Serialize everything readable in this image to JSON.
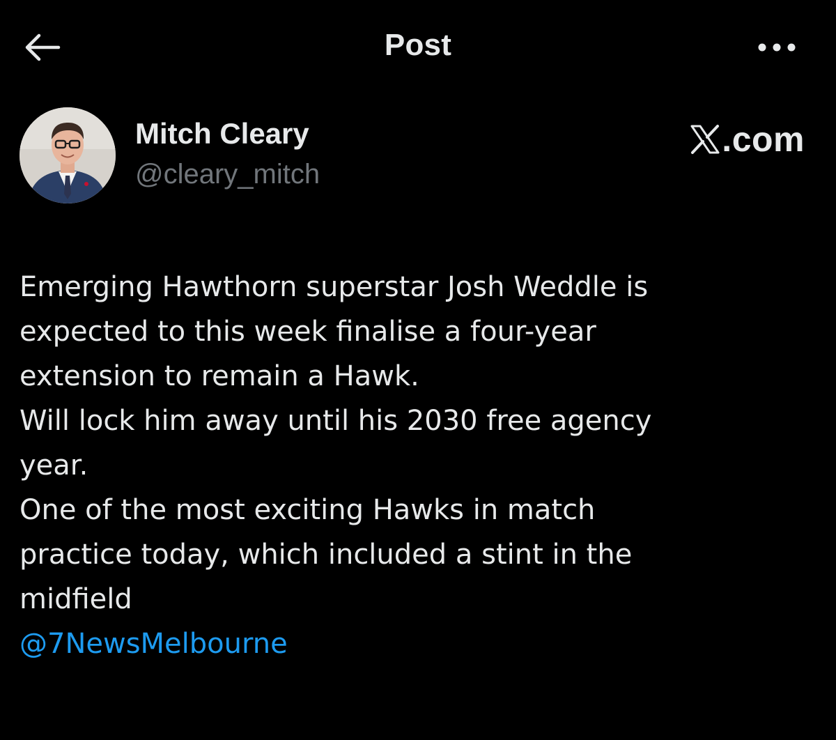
{
  "header": {
    "title": "Post",
    "back_icon": "arrow-left-icon",
    "more_icon": "more-horizontal-icon"
  },
  "author": {
    "name": "Mitch Cleary",
    "handle": "@cleary_mitch"
  },
  "watermark": {
    "logo_letter": "X",
    "text": ".com"
  },
  "post": {
    "lines": [
      "Emerging Hawthorn superstar Josh Weddle is",
      "expected to this week finalise a four-year",
      "extension to remain a Hawk.",
      "Will lock him away until his 2030 free agency",
      "year.",
      "One of the most exciting Hawks in match",
      "practice today, which included a stint in the",
      "midfield"
    ],
    "mention": "@7NewsMelbourne"
  },
  "colors": {
    "background": "#000000",
    "text_primary": "#e7e9ea",
    "text_secondary": "#71767b",
    "link": "#1d9bf0"
  }
}
